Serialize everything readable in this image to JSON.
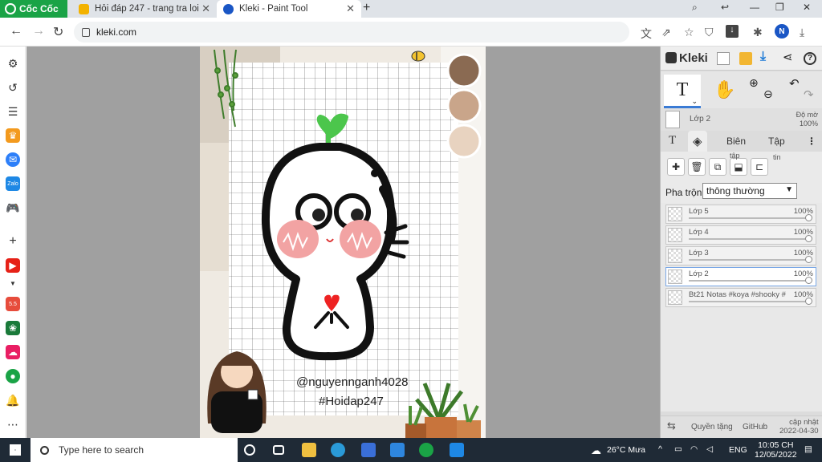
{
  "browser": {
    "brand": "Cốc Cốc",
    "tabs": [
      {
        "title": "Hỏi đáp 247 - trang tra loi"
      },
      {
        "title": "Kleki - Paint Tool"
      }
    ],
    "url": "kleki.com",
    "profile_initial": "N"
  },
  "canvas": {
    "watermark_user": "@nguyennganh4028",
    "watermark_tag": "#Hoidap247",
    "swatches": [
      "#8a6a52",
      "#c9a58a",
      "#e8d3c0"
    ]
  },
  "kleki": {
    "logo": "Kleki",
    "active_tool_glyph": "T",
    "current_layer_name": "Lớp 2",
    "opacity_label": "Độ mờ",
    "opacity_value": "100%",
    "tabs": {
      "text_glyph": "T",
      "edit": "Biên",
      "file": "Tập"
    },
    "tap_hint": "tập",
    "tin_hint": "tin",
    "blend_label": "Pha trộn",
    "blend_value": "thông thường",
    "layers": [
      {
        "name": "Lớp 5",
        "opacity": "100%",
        "active": false
      },
      {
        "name": "Lớp 4",
        "opacity": "100%",
        "active": false
      },
      {
        "name": "Lớp 3",
        "opacity": "100%",
        "active": false
      },
      {
        "name": "Lớp 2",
        "opacity": "100%",
        "active": true
      },
      {
        "name": "Bt21 Notas #koya #shooky #",
        "opacity": "100%",
        "active": false
      }
    ],
    "footer": {
      "privacy": "Quyền tặng",
      "github": "GitHub",
      "updated_label": "cập nhật",
      "updated_date": "2022-04-30"
    }
  },
  "taskbar": {
    "search_placeholder": "Type here to search",
    "weather": "26°C  Mưa",
    "lang": "ENG",
    "time": "10:05 CH",
    "date": "12/05/2022"
  }
}
